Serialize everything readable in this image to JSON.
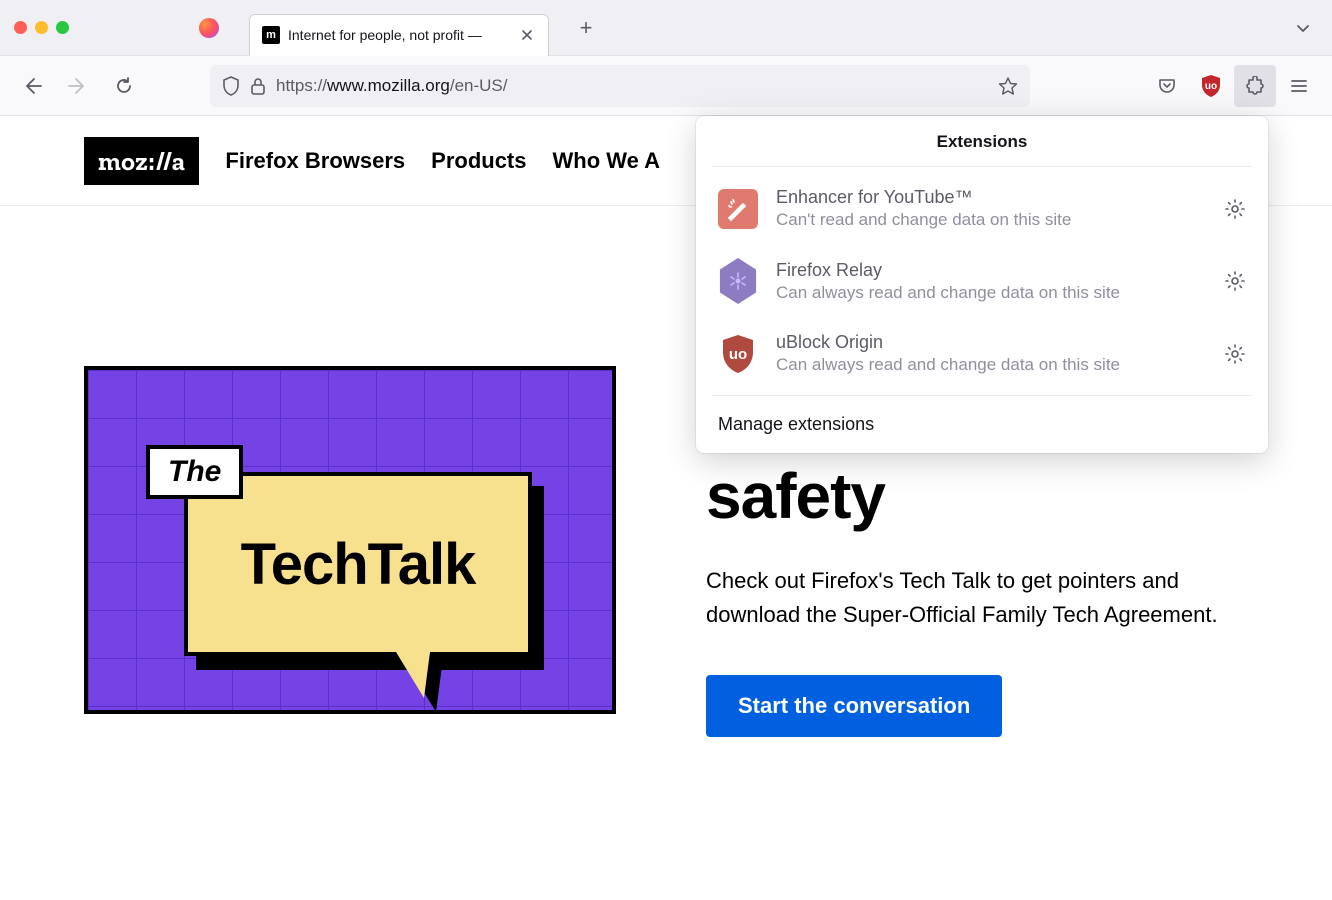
{
  "tab": {
    "title": "Internet for people, not profit —",
    "favicon_char": "m"
  },
  "urlbar": {
    "protocol": "https://",
    "domain": "www.mozilla.org",
    "path": "/en-US/"
  },
  "page": {
    "logo": "moz://a",
    "nav": [
      "Firefox Browsers",
      "Products",
      "Who We A"
    ],
    "graphic": {
      "the": "The",
      "techtalk": "TechTalk"
    },
    "hero_title": "kids about online safety",
    "hero_desc": "Check out Firefox's Tech Talk to get pointers and download the Super-Official Family Tech Agreement.",
    "hero_cta": "Start the conversation"
  },
  "extensions_panel": {
    "title": "Extensions",
    "items": [
      {
        "name": "Enhancer for YouTube™",
        "status": "Can't read and change data on this site"
      },
      {
        "name": "Firefox Relay",
        "status": "Can always read and change data on this site"
      },
      {
        "name": "uBlock Origin",
        "status": "Can always read and change data on this site"
      }
    ],
    "footer": "Manage extensions"
  }
}
